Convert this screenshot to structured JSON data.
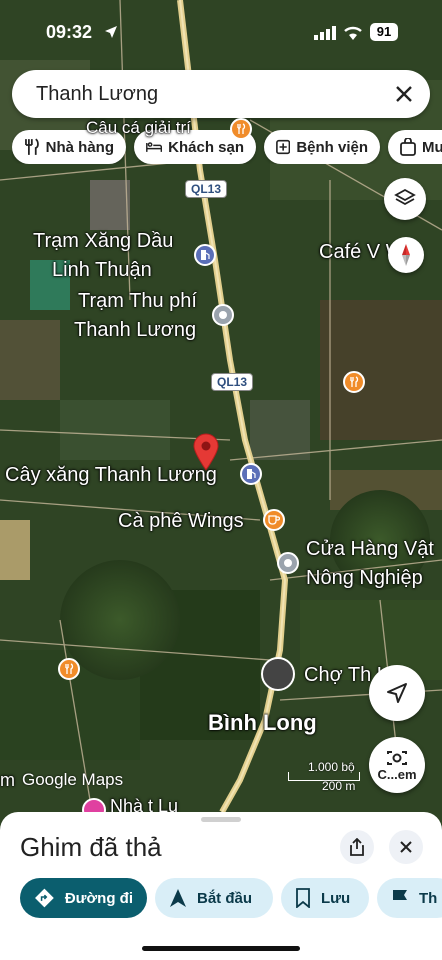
{
  "status_bar": {
    "time": "09:32",
    "battery": "91"
  },
  "search": {
    "query": "Thanh Lương"
  },
  "chips": [
    {
      "label": "Nhà hàng",
      "icon": "restaurant-icon"
    },
    {
      "label": "Khách sạn",
      "icon": "hotel-icon"
    },
    {
      "label": "Bệnh viện",
      "icon": "hospital-icon"
    },
    {
      "label": "Mu",
      "icon": "shopping-bag-icon"
    }
  ],
  "map": {
    "road_shields": [
      "QL13",
      "QL13"
    ],
    "labels": {
      "cau_ca": "Câu cá giải trí",
      "tram_xang_1": "Trạm Xăng Dầu",
      "tram_xang_2": "Linh Thuận",
      "tram_thu_phi_1": "Trạm Thu phí",
      "tram_thu_phi_2": "Thanh Lương",
      "cafe_v": "Café V   W",
      "cay_xang": "Cây xăng Thanh Lương",
      "ca_phe_wings": "Cà phê Wings",
      "cua_hang_1": "Cửa Hàng Vật",
      "cua_hang_2": "Nông Nghiệp",
      "cho": "Chợ Th    Lư",
      "binh_long": "Bình Long",
      "nha_bottom": "Nhà t       Lu ",
      "left_m": "m"
    },
    "google_logo": "Google Maps",
    "scale": {
      "imperial": "1.000 bộ",
      "metric": "200 m"
    }
  },
  "fabs": {
    "camera_label": "C...em"
  },
  "sheet": {
    "title": "Ghim đã thả",
    "actions": [
      {
        "label": "Đường đi",
        "style": "primary"
      },
      {
        "label": "Bắt đầu",
        "style": "secondary"
      },
      {
        "label": "Lưu",
        "style": "secondary"
      },
      {
        "label": "Th",
        "style": "secondary"
      }
    ]
  },
  "colors": {
    "primary_btn": "#0b5e6e",
    "secondary_btn": "#d9eef7",
    "pin": "#e53935",
    "poi_orange": "#f08c2a",
    "poi_blue": "#5b6fb8",
    "poi_gray": "#9aa3ad"
  }
}
